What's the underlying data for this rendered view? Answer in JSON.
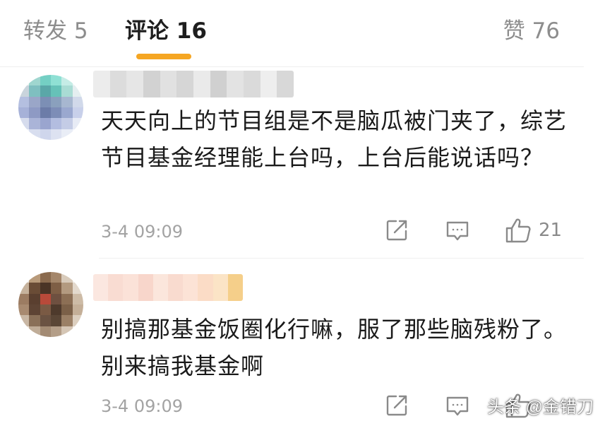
{
  "tabs": {
    "repost": "转发 5",
    "comments": "评论 16",
    "likes": "赞 76"
  },
  "comments": [
    {
      "text": "天天向上的节目组是不是脑瓜被门夹了，综艺节目基金经理能上台吗，上台后能说话吗？",
      "timestamp": "3-4 09:09",
      "like_count": "21"
    },
    {
      "text": "别搞那基金饭圈化行嘛，服了那些脑残粉了。别来搞我基金啊",
      "timestamp": "3-4 09:09",
      "like_count": ""
    }
  ],
  "icons": {
    "share": "share-icon",
    "reply": "comment-icon",
    "like": "thumbs-up-icon"
  },
  "colors": {
    "accent": "#f5a623",
    "muted_text": "#a3a3a3",
    "icon_gray": "#8a8a8a"
  },
  "watermark": "头条 @金错刀"
}
